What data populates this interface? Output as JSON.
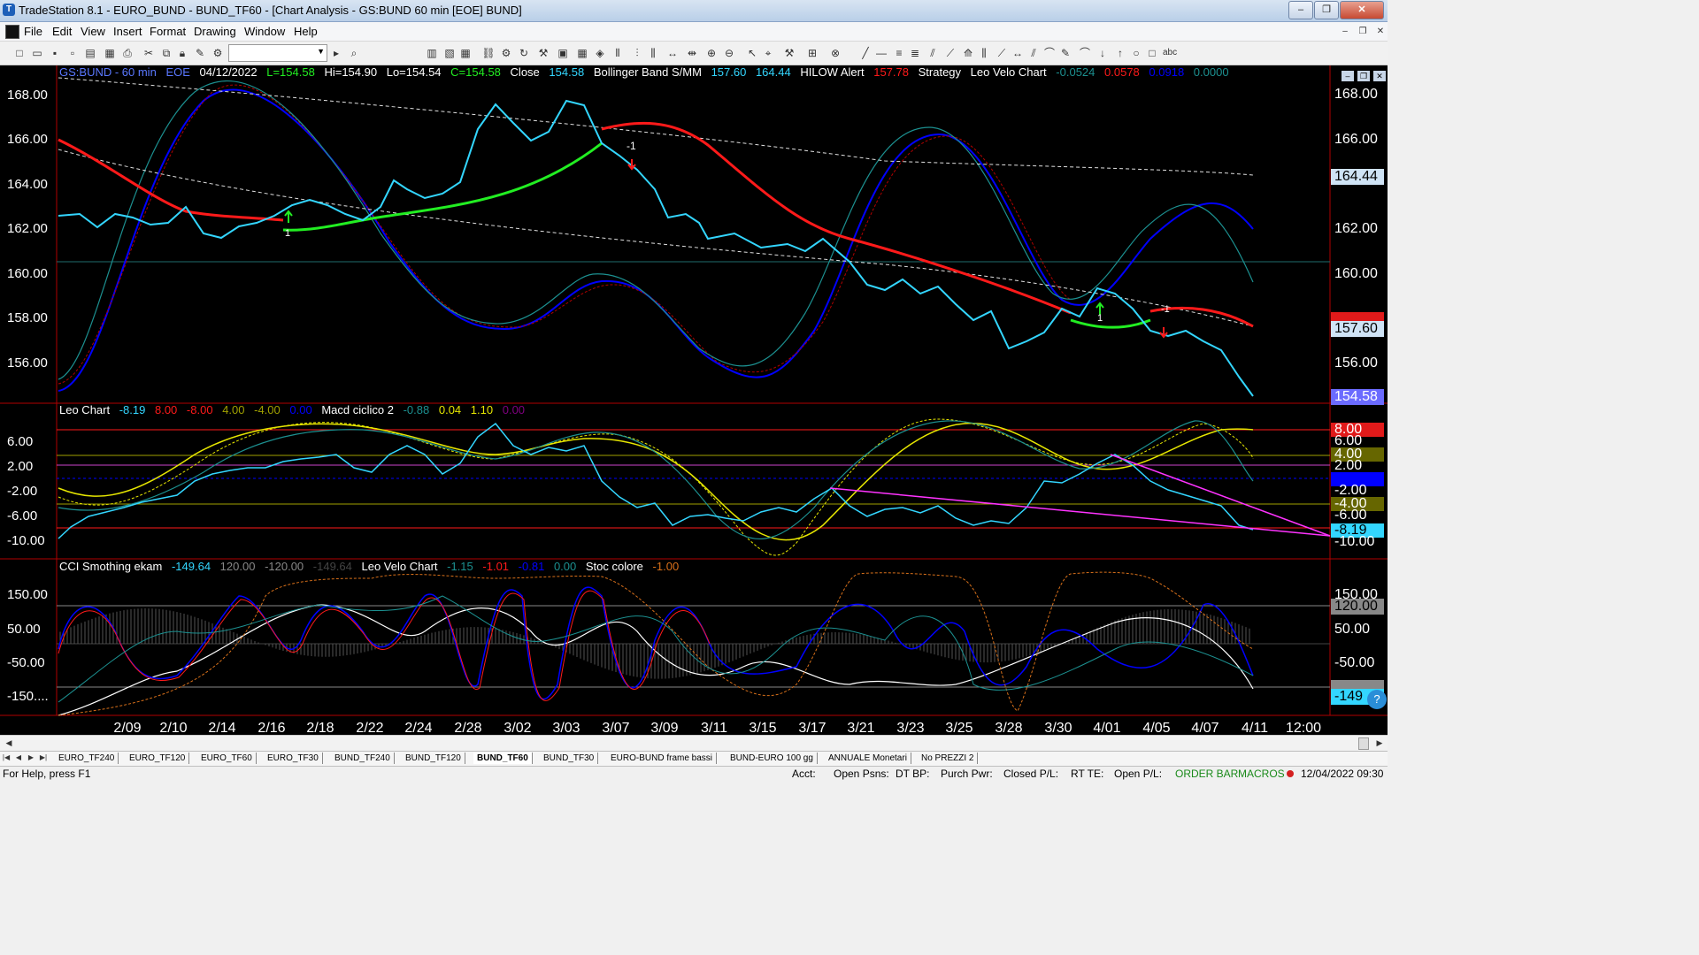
{
  "window": {
    "app_title": "TradeStation 8.1 - EURO_BUND - BUND_TF60 - [Chart Analysis - GS:BUND  60 min  [EOE] BUND]",
    "minimize": "–",
    "maximize": "❐",
    "close": "✕"
  },
  "menu": {
    "items": [
      "File",
      "Edit",
      "View",
      "Insert",
      "Format",
      "Drawing",
      "Window",
      "Help"
    ]
  },
  "chart": {
    "price_header": {
      "symbol": "GS:BUND - 60 min",
      "feed": "EOE",
      "date": "04/12/2022",
      "last": "L=154.58",
      "high": "Hi=154.90",
      "low": "Lo=154.54",
      "close_c": "C=154.58",
      "close_label": "Close",
      "close_val": "154.58",
      "bb_label": "Bollinger Band S/MM",
      "bb_v1": "157.60",
      "bb_v2": "164.44",
      "hilow_label": "HILOW Alert",
      "hilow_val": "157.78",
      "strategy_label": "Strategy",
      "leo_velo_label": "Leo Velo Chart",
      "lv1": "-0.0524",
      "lv2": "0.0578",
      "lv3": "0.0918",
      "lv4": "0.0000"
    },
    "osc_header": {
      "leo_label": "Leo Chart",
      "v1": "-8.19",
      "v2": "8.00",
      "v3": "-8.00",
      "v4": "4.00",
      "v5": "-4.00",
      "v6": "0.00",
      "macd_label": "Macd ciclico 2",
      "m1": "-0.88",
      "m2": "0.04",
      "m3": "1.10",
      "m4": "0.00"
    },
    "cci_header": {
      "cci_label": "CCI Smothing ekam",
      "c1": "-149.64",
      "c2": "120.00",
      "c3": "-120.00",
      "c4": "-149.64",
      "leo_velo_label": "Leo Velo Chart",
      "l1": "-1.15",
      "l2": "-1.01",
      "l3": "-0.81",
      "l4": "0.00",
      "stoc_label": "Stoc colore",
      "s1": "-1.00"
    },
    "price_axis": [
      "168.00",
      "166.00",
      "164.00",
      "162.00",
      "160.00",
      "158.00",
      "156.00"
    ],
    "price_tags": {
      "upper_band": "164.44",
      "lower_band": "157.60",
      "last": "154.58",
      "partial": "158.00"
    },
    "osc_axis": [
      "6.00",
      "2.00",
      "-2.00",
      "-6.00",
      "-10.00"
    ],
    "osc_tags": [
      "8.00",
      "6.00",
      "4.00",
      "2.00",
      "0.00",
      "-2.00",
      "-4.00",
      "-6.00",
      "-8.19",
      "-10.00"
    ],
    "cci_axis": [
      "150.00",
      "50.00",
      "-50.00",
      "-150...."
    ],
    "cci_tags": [
      "150.00",
      "120.00",
      "50.00",
      "-50.00",
      "-120.00",
      "-149"
    ],
    "x_axis": [
      "2/09",
      "2/10",
      "2/14",
      "2/16",
      "2/18",
      "2/22",
      "2/24",
      "2/28",
      "3/02",
      "3/03",
      "3/07",
      "3/09",
      "3/11",
      "3/15",
      "3/17",
      "3/21",
      "3/23",
      "3/25",
      "3/28",
      "3/30",
      "4/01",
      "4/05",
      "4/07",
      "4/11",
      "12:00"
    ],
    "signal_labels": [
      "1",
      "-1",
      "1",
      "-1"
    ],
    "colors": {
      "price": "#33d6ff",
      "ma_down": "#ff1a1a",
      "ma_up": "#22ee22",
      "band": "#0000ff",
      "osc_yellow": "#e6e600",
      "trend": "#ff33ff"
    }
  },
  "sheet_tabs": [
    "EURO_TF240",
    "EURO_TF120",
    "EURO_TF60",
    "EURO_TF30",
    "BUND_TF240",
    "BUND_TF120",
    "BUND_TF60",
    "BUND_TF30",
    "EURO-BUND frame bassi",
    "BUND-EURO 100 gg",
    "ANNUALE Monetari",
    "No PREZZI 2"
  ],
  "active_tab": "BUND_TF60",
  "status": {
    "help": "For Help, press F1",
    "acct": "Acct:",
    "open_psns": "Open Psns:",
    "dt_bp": "DT BP:",
    "purch_pwr": "Purch Pwr:",
    "closed_pl": "Closed P/L:",
    "rt_te": "RT TE:",
    "open_pl": "Open P/L:",
    "order_bar": "ORDER BAR",
    "macros": "MACROS",
    "datetime": "12/04/2022 09:30"
  }
}
